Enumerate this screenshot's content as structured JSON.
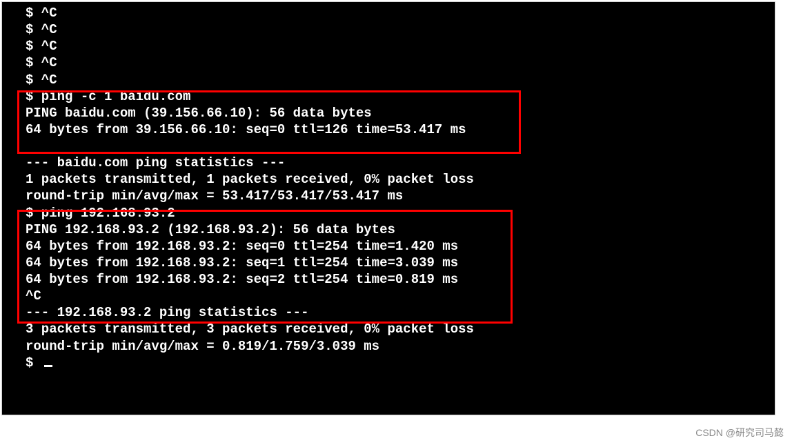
{
  "terminal": {
    "lines": {
      "l0": "$ ^C",
      "l1": "$ ^C",
      "l2": "$ ^C",
      "l3": "$ ^C",
      "l4": "$ ^C",
      "l5": "$ ping -c 1 baidu.com",
      "l6": "PING baidu.com (39.156.66.10): 56 data bytes",
      "l7": "64 bytes from 39.156.66.10: seq=0 ttl=126 time=53.417 ms",
      "l8": "",
      "l9": "--- baidu.com ping statistics ---",
      "l10": "1 packets transmitted, 1 packets received, 0% packet loss",
      "l11": "round-trip min/avg/max = 53.417/53.417/53.417 ms",
      "l12": "$ ping 192.168.93.2",
      "l13": "PING 192.168.93.2 (192.168.93.2): 56 data bytes",
      "l14": "64 bytes from 192.168.93.2: seq=0 ttl=254 time=1.420 ms",
      "l15": "64 bytes from 192.168.93.2: seq=1 ttl=254 time=3.039 ms",
      "l16": "64 bytes from 192.168.93.2: seq=2 ttl=254 time=0.819 ms",
      "l17": "^C",
      "l18": "--- 192.168.93.2 ping statistics ---",
      "l19": "3 packets transmitted, 3 packets received, 0% packet loss",
      "l20": "round-trip min/avg/max = 0.819/1.759/3.039 ms",
      "l21": "$ "
    }
  },
  "watermark": "CSDN @研究司马懿"
}
